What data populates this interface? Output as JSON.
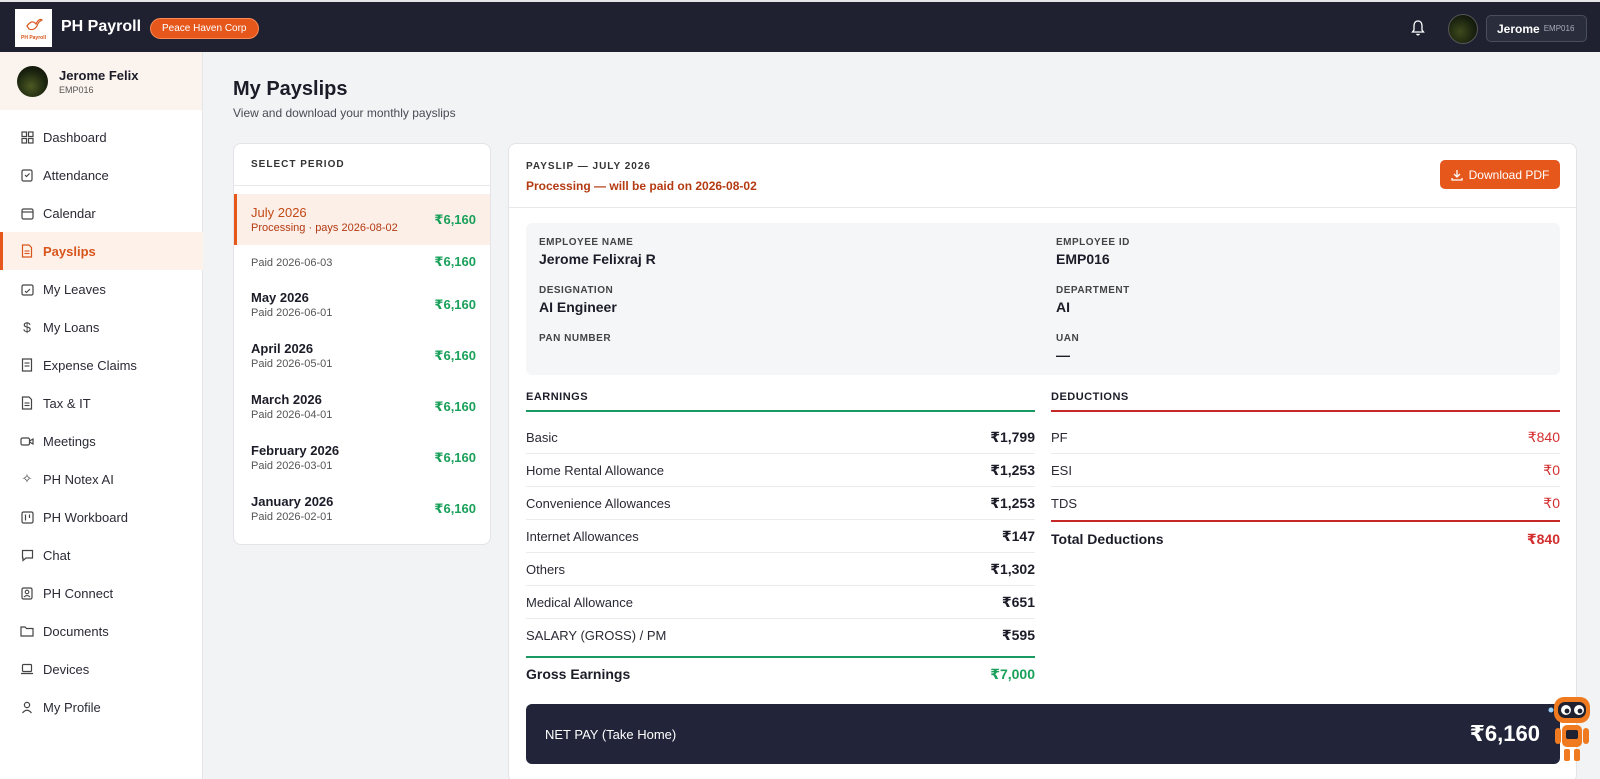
{
  "app": {
    "title": "PH Payroll",
    "company": "Peace Haven Corp",
    "logo_text": "PH Payroll"
  },
  "header": {
    "user_name": "Jerome",
    "user_id": "EMP016"
  },
  "sidebar": {
    "profile": {
      "name": "Jerome Felix",
      "id": "EMP016"
    },
    "items": [
      {
        "label": "Dashboard",
        "icon": "grid-icon"
      },
      {
        "label": "Attendance",
        "icon": "clipboard-icon"
      },
      {
        "label": "Calendar",
        "icon": "calendar-icon"
      },
      {
        "label": "Payslips",
        "icon": "document-icon",
        "active": true
      },
      {
        "label": "My Leaves",
        "icon": "calendar-check-icon"
      },
      {
        "label": "My Loans",
        "icon": "dollar-icon"
      },
      {
        "label": "Expense Claims",
        "icon": "receipt-icon"
      },
      {
        "label": "Tax & IT",
        "icon": "file-icon"
      },
      {
        "label": "Meetings",
        "icon": "video-icon"
      },
      {
        "label": "PH Notex AI",
        "icon": "sparkle-icon"
      },
      {
        "label": "PH Workboard",
        "icon": "board-icon"
      },
      {
        "label": "Chat",
        "icon": "chat-icon"
      },
      {
        "label": "PH Connect",
        "icon": "contact-icon"
      },
      {
        "label": "Documents",
        "icon": "folder-icon"
      },
      {
        "label": "Devices",
        "icon": "laptop-icon"
      },
      {
        "label": "My Profile",
        "icon": "user-icon"
      }
    ]
  },
  "page": {
    "title": "My Payslips",
    "subtitle": "View and download your monthly payslips"
  },
  "periods": {
    "heading": "SELECT PERIOD",
    "items": [
      {
        "month": "July 2026",
        "sub": "Processing · pays 2026-08-02",
        "amount": "₹6,160",
        "active": true
      },
      {
        "month": "",
        "sub": "Paid 2026-06-03",
        "amount": "₹6,160"
      },
      {
        "month": "May 2026",
        "sub": "Paid 2026-06-01",
        "amount": "₹6,160"
      },
      {
        "month": "April 2026",
        "sub": "Paid 2026-05-01",
        "amount": "₹6,160"
      },
      {
        "month": "March 2026",
        "sub": "Paid 2026-04-01",
        "amount": "₹6,160"
      },
      {
        "month": "February 2026",
        "sub": "Paid 2026-03-01",
        "amount": "₹6,160"
      },
      {
        "month": "January 2026",
        "sub": "Paid 2026-02-01",
        "amount": "₹6,160"
      }
    ]
  },
  "payslip": {
    "label": "PAYSLIP — JULY 2026",
    "status": "Processing — will be paid on 2026-08-02",
    "download_label": "Download PDF",
    "info": {
      "employee_name_label": "EMPLOYEE NAME",
      "employee_name": "Jerome Felixraj R",
      "employee_id_label": "EMPLOYEE ID",
      "employee_id": "EMP016",
      "designation_label": "DESIGNATION",
      "designation": "AI Engineer",
      "department_label": "DEPARTMENT",
      "department": "AI",
      "pan_label": "PAN NUMBER",
      "pan": "",
      "uan_label": "UAN",
      "uan": "—"
    },
    "earnings": {
      "title": "EARNINGS",
      "lines": [
        {
          "label": "Basic",
          "amount": "₹1,799"
        },
        {
          "label": "Home Rental Allowance",
          "amount": "₹1,253"
        },
        {
          "label": "Convenience Allowances",
          "amount": "₹1,253"
        },
        {
          "label": "Internet Allowances",
          "amount": "₹147"
        },
        {
          "label": "Others",
          "amount": "₹1,302"
        },
        {
          "label": "Medical Allowance",
          "amount": "₹651"
        },
        {
          "label": "SALARY (GROSS) / PM",
          "amount": "₹595"
        }
      ],
      "total_label": "Gross Earnings",
      "total": "₹7,000"
    },
    "deductions": {
      "title": "DEDUCTIONS",
      "lines": [
        {
          "label": "PF",
          "amount": "₹840"
        },
        {
          "label": "ESI",
          "amount": "₹0"
        },
        {
          "label": "TDS",
          "amount": "₹0"
        }
      ],
      "total_label": "Total Deductions",
      "total": "₹840"
    },
    "net_label": "NET PAY (Take Home)",
    "net": "₹6,160"
  },
  "colors": {
    "accent": "#e5571b",
    "topbar": "#1f2130",
    "green": "#1aa05a",
    "red": "#d32f2f"
  }
}
